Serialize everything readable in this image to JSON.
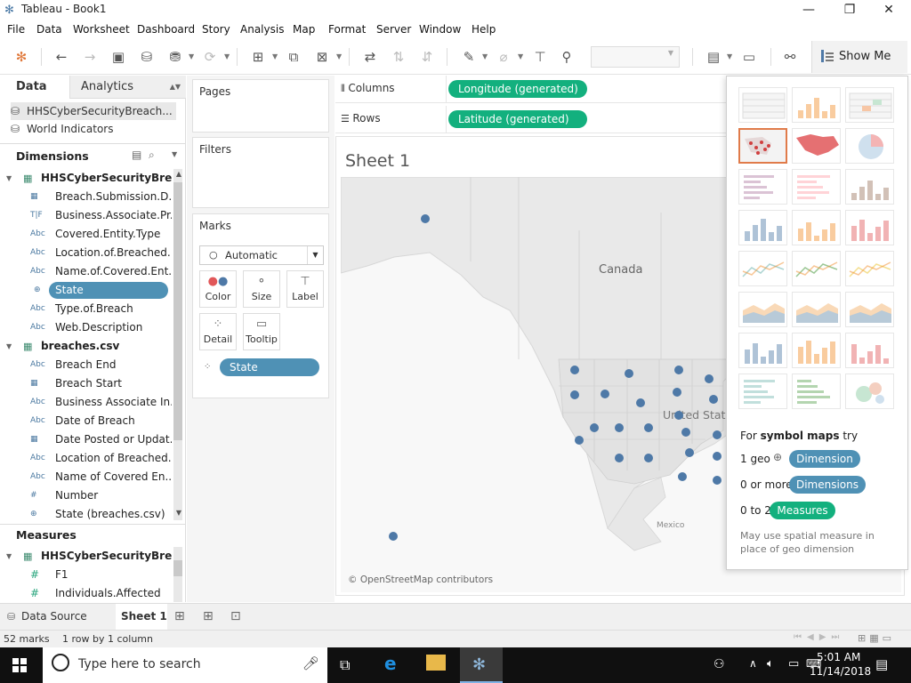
{
  "window": {
    "title": "Tableau - Book1"
  },
  "menu": [
    "File",
    "Data",
    "Worksheet",
    "Dashboard",
    "Story",
    "Analysis",
    "Map",
    "Format",
    "Server",
    "Window",
    "Help"
  ],
  "toolbar": {
    "show_me_label": "Show Me"
  },
  "datapane": {
    "tab_data": "Data",
    "tab_analytics": "Analytics",
    "sources": [
      "HHSCyberSecurityBreach...",
      "World Indicators"
    ],
    "dimensions_label": "Dimensions",
    "measures_label": "Measures",
    "groups": [
      {
        "label": "HHSCyberSecurityBre...",
        "fields": [
          {
            "icon": "calendar",
            "type": "date",
            "label": "Breach.Submission.D..."
          },
          {
            "icon": "T|F",
            "type": "bool",
            "label": "Business.Associate.Pr..."
          },
          {
            "icon": "Abc",
            "type": "str",
            "label": "Covered.Entity.Type"
          },
          {
            "icon": "Abc",
            "type": "str",
            "label": "Location.of.Breached..."
          },
          {
            "icon": "Abc",
            "type": "str",
            "label": "Name.of.Covered.Ent..."
          },
          {
            "icon": "globe",
            "type": "geo",
            "label": "State",
            "selected": true
          },
          {
            "icon": "Abc",
            "type": "str",
            "label": "Type.of.Breach"
          },
          {
            "icon": "Abc",
            "type": "str",
            "label": "Web.Description"
          }
        ]
      },
      {
        "label": "breaches.csv",
        "fields": [
          {
            "icon": "Abc",
            "type": "str",
            "label": "Breach End"
          },
          {
            "icon": "calendar",
            "type": "date",
            "label": "Breach Start"
          },
          {
            "icon": "Abc",
            "type": "str",
            "label": "Business Associate In..."
          },
          {
            "icon": "Abc",
            "type": "str",
            "label": "Date of Breach"
          },
          {
            "icon": "calendar",
            "type": "date",
            "label": "Date Posted or Updat..."
          },
          {
            "icon": "Abc",
            "type": "str",
            "label": "Location of Breached..."
          },
          {
            "icon": "Abc",
            "type": "str",
            "label": "Name of Covered En..."
          },
          {
            "icon": "#",
            "type": "num",
            "label": "Number"
          },
          {
            "icon": "globe",
            "type": "geo",
            "label": "State (breaches.csv)"
          }
        ]
      }
    ],
    "measure_group": {
      "label": "HHSCyberSecurityBre...",
      "fields": [
        {
          "icon": "#",
          "label": "F1"
        },
        {
          "icon": "#",
          "label": "Individuals.Affected"
        }
      ]
    }
  },
  "shelves": {
    "pages": "Pages",
    "filters": "Filters",
    "marks": "Marks",
    "mark_type": "Automatic",
    "mark_buttons": [
      "Color",
      "Size",
      "Label",
      "Detail",
      "Tooltip"
    ],
    "detail_pill": "State",
    "columns_label": "Columns",
    "rows_label": "Rows",
    "columns_pill": "Longitude (generated)",
    "rows_pill": "Latitude (generated)"
  },
  "sheet": {
    "title": "Sheet 1",
    "map_labels": {
      "canada": "Canada",
      "us": "United States",
      "mexico": "Mexico"
    },
    "copyright": "© OpenStreetMap contributors",
    "point_color": "#4e79a7"
  },
  "showme": {
    "prompt_prefix": "For ",
    "prompt_bold": "symbol maps",
    "prompt_suffix": " try",
    "req1_label": "1 geo",
    "req1_pill": "Dimension",
    "req2_label": "0 or more",
    "req2_pill": "Dimensions",
    "req3_label": "0 to 2",
    "req3_pill": "Measures",
    "note": "May use spatial measure in place of geo dimension"
  },
  "tabs": {
    "datasource": "Data Source",
    "sheet": "Sheet 1"
  },
  "status": {
    "marks": "52 marks",
    "layout": "1 row by 1 column"
  },
  "taskbar": {
    "search_placeholder": "Type here to search",
    "time": "5:01 AM",
    "date": "11/14/2018"
  }
}
